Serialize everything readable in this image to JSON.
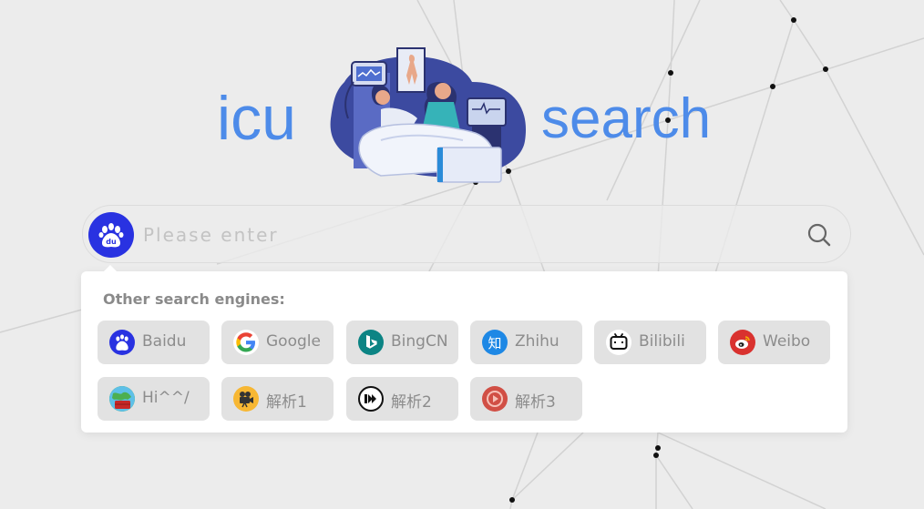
{
  "logo": {
    "left_word": "icu",
    "right_word": "search",
    "color": "#4d8be9"
  },
  "search": {
    "placeholder": "Please enter",
    "value": "",
    "current_engine_icon": "baidu-paw-icon",
    "button_icon": "search-icon"
  },
  "panel": {
    "title": "Other search engines:",
    "engines": [
      {
        "label": "Baidu",
        "icon": "baidu-paw-icon"
      },
      {
        "label": "Google",
        "icon": "google-g-icon"
      },
      {
        "label": "BingCN",
        "icon": "bing-icon"
      },
      {
        "label": "Zhihu",
        "icon": "zhihu-icon"
      },
      {
        "label": "Bilibili",
        "icon": "bilibili-tv-icon"
      },
      {
        "label": "Weibo",
        "icon": "weibo-icon"
      },
      {
        "label": "Hi^^/",
        "icon": "globe-icon"
      },
      {
        "label": "解析1",
        "icon": "film-camera-icon"
      },
      {
        "label": "解析2",
        "icon": "fast-forward-icon"
      },
      {
        "label": "解析3",
        "icon": "play-circle-icon"
      }
    ]
  }
}
